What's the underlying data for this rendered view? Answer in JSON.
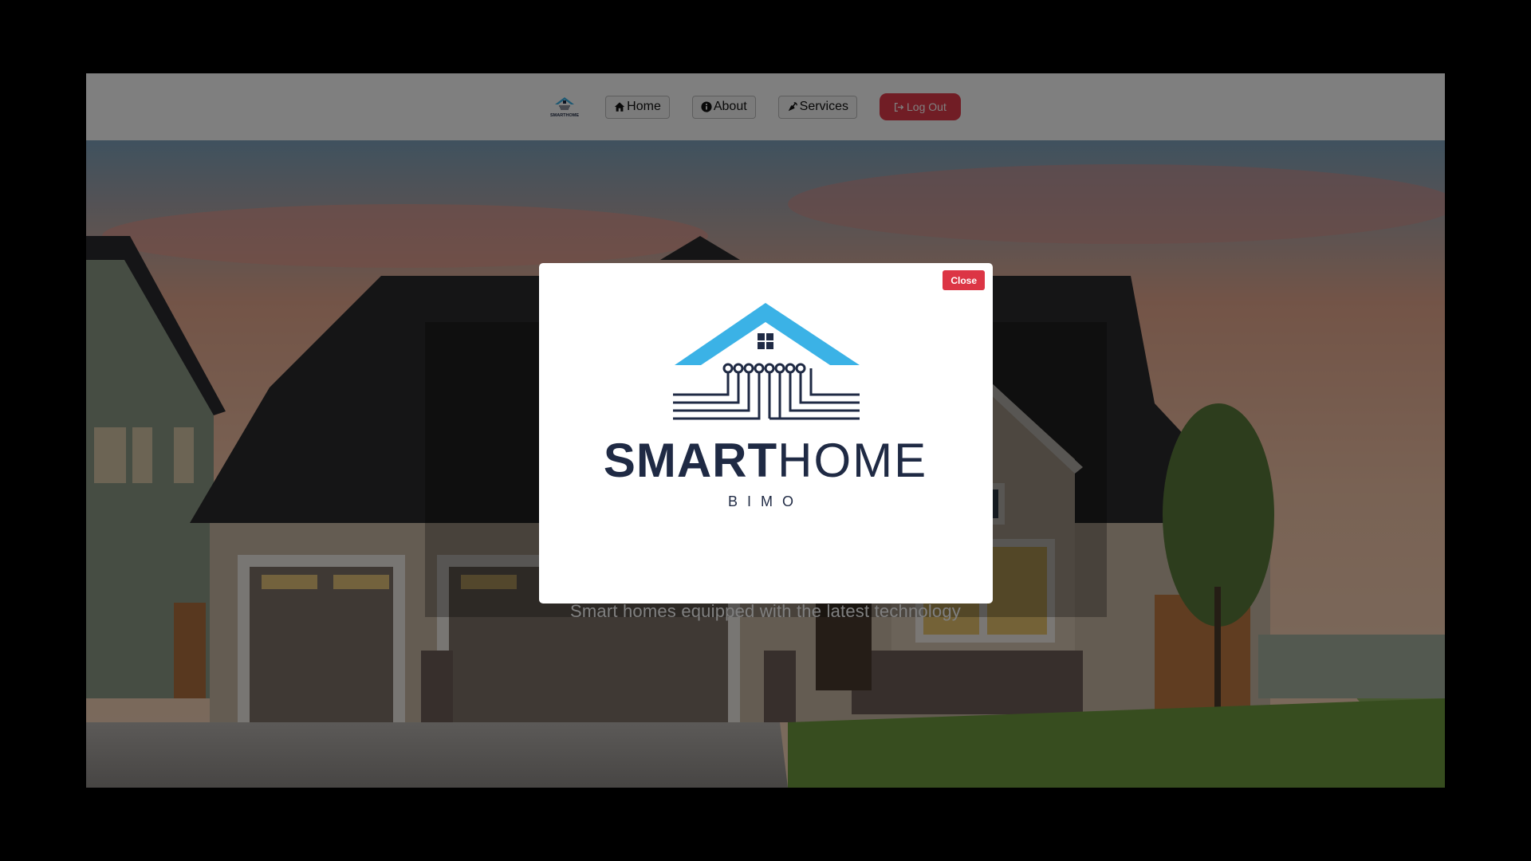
{
  "nav": {
    "logo_text": "SMARTHOME",
    "items": [
      {
        "label": "Home",
        "icon": "home-icon"
      },
      {
        "label": "About",
        "icon": "info-circle-icon"
      },
      {
        "label": "Services",
        "icon": "satellite-dish-icon"
      }
    ],
    "logout_label": "Log Out",
    "logout_icon": "logout-icon"
  },
  "hero": {
    "subtitle": "Smart homes equipped with the latest technology"
  },
  "modal": {
    "close_label": "Close",
    "logo_primary": "SMART",
    "logo_secondary": "HOME",
    "logo_tagline": "BIMO"
  },
  "colors": {
    "logout": "#e23a4a",
    "close": "#dc3545",
    "logo_roof": "#3bb2e6",
    "logo_dark": "#1f2a44"
  }
}
